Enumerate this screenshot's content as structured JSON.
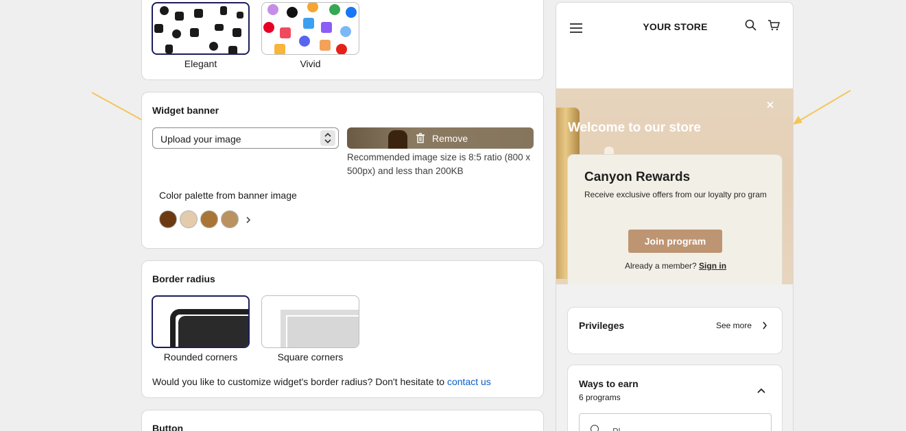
{
  "icon_style": {
    "options": [
      {
        "label": "Elegant",
        "selected": true
      },
      {
        "label": "Vivid",
        "selected": false
      }
    ]
  },
  "widget_banner": {
    "title": "Widget banner",
    "select_value": "Upload your image",
    "remove_label": "Remove",
    "hint": "Recommended image size is 8:5 ratio (800 x 500px) and less than 200KB",
    "palette_label": "Color palette from banner image",
    "palette": [
      "#6b3a12",
      "#e3cbac",
      "#a87536",
      "#b99260"
    ]
  },
  "border_radius": {
    "title": "Border radius",
    "options": [
      {
        "label": "Rounded corners",
        "selected": true
      },
      {
        "label": "Square corners",
        "selected": false
      }
    ],
    "question": "Would you like to customize widget's border radius? Don't hesitate to ",
    "link": "contact us"
  },
  "button_section": {
    "title": "Button"
  },
  "preview": {
    "store_name": "YOUR STORE",
    "welcome": "Welcome to our store",
    "rewards_title": "Canyon Rewards",
    "rewards_desc": "Receive exclusive offers from our loyalty pro gram",
    "join_label": "Join program",
    "member_text": "Already a member?",
    "sign_in": "Sign in",
    "privileges": "Privileges",
    "see_more": "See more",
    "ways_to_earn": "Ways to earn",
    "programs_count": "6 programs",
    "search_placeholder": "Pl"
  },
  "colors": {
    "selected_border": "#1c1c5c",
    "link": "#0b5cc4",
    "join_button": "#be9572",
    "arrow": "#f5c55a"
  }
}
